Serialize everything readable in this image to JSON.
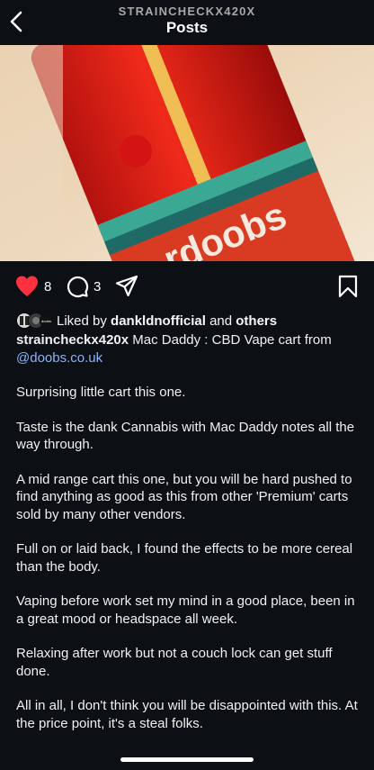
{
  "header": {
    "username": "STRAINCHECKX420X",
    "title": "Posts"
  },
  "post": {
    "likes": "8",
    "comments": "3",
    "liked_by_prefix": "Liked by",
    "liked_by_user": "dankldnofficial",
    "liked_by_and": "and",
    "liked_by_others": "others",
    "author": "straincheckx420x",
    "caption_first": "Mac Daddy :  CBD Vape cart from",
    "mention": "@doobs.co.uk",
    "paragraphs": [
      "Surprising little cart this one.",
      "Taste is the dank Cannabis with Mac Daddy notes all the way through.",
      "A mid range cart this one, but you will be hard pushed to find anything as good as this  from other 'Premium' carts sold by many other vendors.",
      "Full on or laid back, I found the effects to be more cereal  than the body.",
      "Vaping before work set my mind in a good place, been in a great mood or headspace all week.",
      "Relaxing after work but not a couch lock can get stuff done.",
      "All in all, I don't think you will be disappointed with this. At the price point, it's a steal folks."
    ],
    "image_text": "rdoobs",
    "avatar_text": "doobs"
  },
  "colors": {
    "background": "#0c1014",
    "like_red": "#ff3040",
    "mention_blue": "#8ab4f8"
  },
  "icons": [
    "back-chevron-icon",
    "heart-icon",
    "comment-icon",
    "share-icon",
    "bookmark-icon"
  ]
}
